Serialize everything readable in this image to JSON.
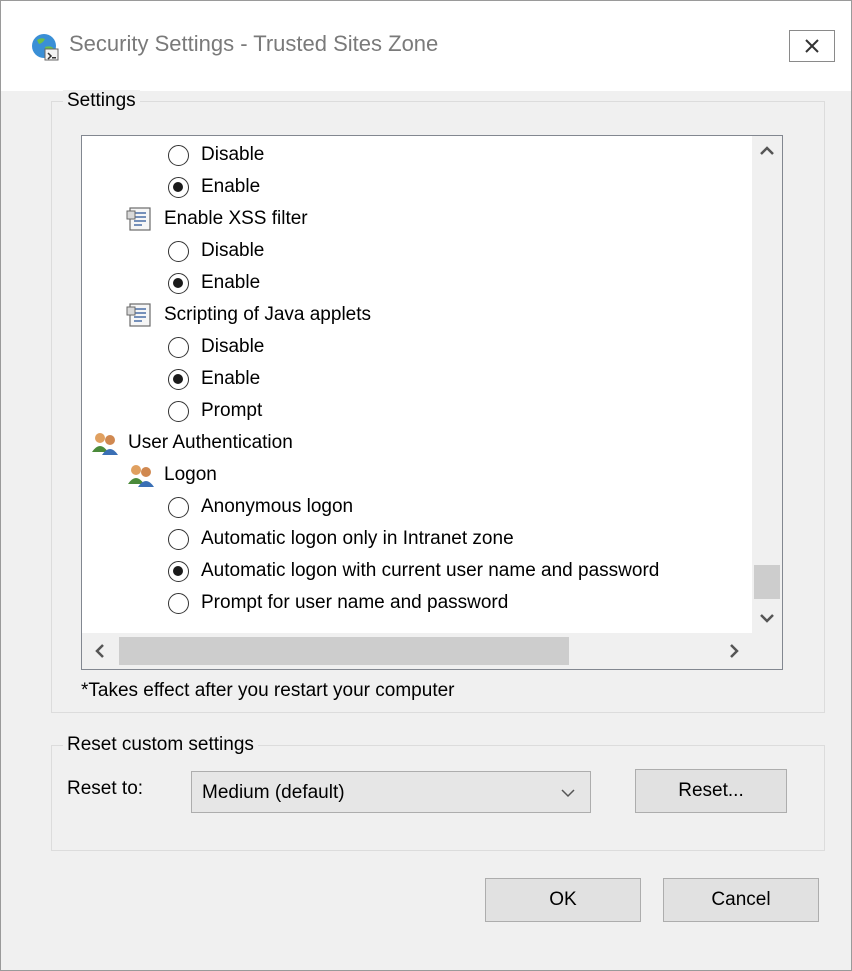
{
  "window": {
    "title": "Security Settings - Trusted Sites Zone",
    "close_label": "close"
  },
  "settings_group": {
    "label": "Settings",
    "rows": [
      {
        "type": "radio",
        "label": "Disable",
        "checked": false
      },
      {
        "type": "radio",
        "label": "Enable",
        "checked": true
      },
      {
        "type": "category",
        "label": "Enable XSS filter",
        "icon": "document-settings-icon"
      },
      {
        "type": "radio",
        "label": "Disable",
        "checked": false
      },
      {
        "type": "radio",
        "label": "Enable",
        "checked": true
      },
      {
        "type": "category",
        "label": "Scripting of Java applets",
        "icon": "document-settings-icon"
      },
      {
        "type": "radio",
        "label": "Disable",
        "checked": false
      },
      {
        "type": "radio",
        "label": "Enable",
        "checked": true
      },
      {
        "type": "radio",
        "label": "Prompt",
        "checked": false
      },
      {
        "type": "category",
        "label": "User Authentication",
        "icon": "users-icon"
      },
      {
        "type": "category",
        "label": "Logon",
        "icon": "users-icon"
      },
      {
        "type": "radio",
        "label": "Anonymous logon",
        "checked": false
      },
      {
        "type": "radio",
        "label": "Automatic logon only in Intranet zone",
        "checked": false
      },
      {
        "type": "radio",
        "label": "Automatic logon with current user name and password",
        "checked": true
      },
      {
        "type": "radio",
        "label": "Prompt for user name and password",
        "checked": false
      }
    ],
    "note": "*Takes effect after you restart your computer"
  },
  "reset_group": {
    "label": "Reset custom settings",
    "reset_to_label": "Reset to:",
    "selected_level": "Medium (default)",
    "reset_button": "Reset..."
  },
  "footer": {
    "ok": "OK",
    "cancel": "Cancel"
  }
}
